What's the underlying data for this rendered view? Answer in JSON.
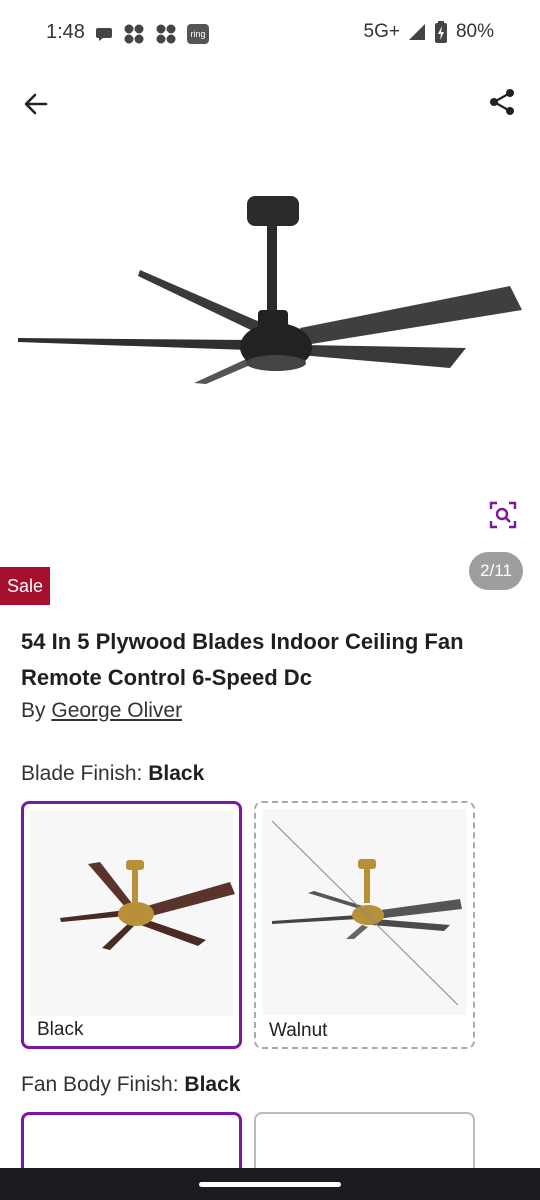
{
  "status_bar": {
    "time": "1:48",
    "left_icons": [
      "chat-bubble-icon",
      "fan-app-icon",
      "fan-app-icon",
      "ring-app-icon"
    ],
    "ring_label": "ring",
    "network": "5G+",
    "battery": "80%"
  },
  "appbar": {
    "back_icon": "arrow-left-icon",
    "share_icon": "share-icon"
  },
  "gallery": {
    "counter": "2/11",
    "zoom_icon": "zoom-search-icon"
  },
  "badge": {
    "sale": "Sale"
  },
  "product": {
    "title": "54 In 5 Plywood Blades Indoor Ceiling Fan Remote Control 6-Speed Dc",
    "by_prefix": "By",
    "brand": "George Oliver"
  },
  "blade_finish": {
    "label": "Blade Finish:",
    "selected": "Black",
    "options": [
      {
        "name": "Black",
        "state": "selected"
      },
      {
        "name": "Walnut",
        "state": "unavailable"
      }
    ]
  },
  "fan_body_finish": {
    "label": "Fan Body Finish:",
    "selected": "Black"
  },
  "colors": {
    "accent": "#7b189f",
    "sale": "#a6102f",
    "counter_bg": "#9e9e9e"
  }
}
